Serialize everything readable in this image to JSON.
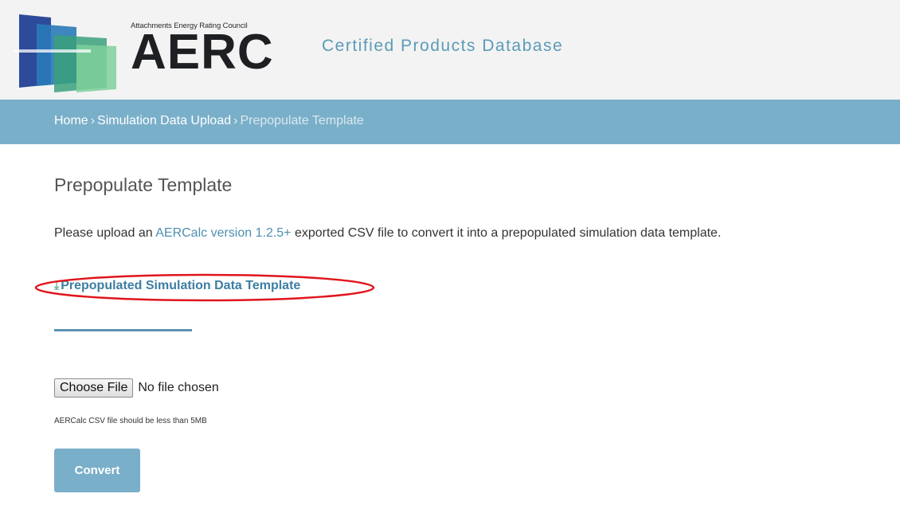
{
  "header": {
    "logo_tagline": "Attachments Energy Rating Council",
    "logo_word": "AERC",
    "site_title": "Certified Products Database",
    "logo_colors": [
      "#2e4a9a",
      "#2a7ab8",
      "#3aa07a",
      "#7fcf9b"
    ],
    "title_color": "#5b9bb8"
  },
  "breadcrumb": {
    "items": [
      {
        "label": "Home"
      },
      {
        "label": "Simulation Data Upload"
      },
      {
        "label": "Prepopulate Template"
      }
    ],
    "separator": "›",
    "bar_color": "#7aafc9"
  },
  "main": {
    "title": "Prepopulate Template",
    "intro_before": "Please upload an ",
    "intro_link": "AERCalc version 1.2.5+",
    "intro_after": " exported CSV file to convert it into a prepopulated simulation data template.",
    "download_icon": "download-icon",
    "download_label": "Prepopulated Simulation Data Template",
    "choose_file_label": "Choose File",
    "no_file_text": "No file chosen",
    "file_hint": "AERCalc CSV file should be less than 5MB",
    "convert_label": "Convert",
    "highlight_color": "#e0151b"
  }
}
